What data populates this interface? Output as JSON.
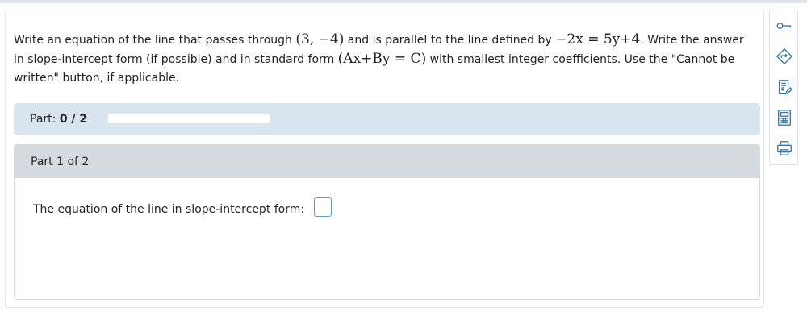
{
  "question": {
    "text_1": "Write an equation of the line that passes through ",
    "point": "(3, −4)",
    "text_2": " and is parallel to the line defined by ",
    "line_equation": "−2x = 5y+4",
    "text_3": ". Write the answer in slope-intercept form (if possible) and in standard form ",
    "standard_form": "(Ax+By = C)",
    "text_4": " with smallest integer coefficients. Use the \"Cannot be written\" button, if applicable."
  },
  "progress": {
    "label": "Part:",
    "value_text": "0 / 2",
    "completed_fraction": 0
  },
  "part": {
    "title": "Part 1 of 2",
    "answer_label": "The equation of the line in slope-intercept form:",
    "answer_value": ""
  },
  "tools": [
    {
      "icon": "key-icon"
    },
    {
      "icon": "hint-icon"
    },
    {
      "icon": "notes-icon"
    },
    {
      "icon": "calculator-icon"
    },
    {
      "icon": "print-icon"
    }
  ],
  "colors": {
    "progress_bg": "#d9e5ee",
    "part_header_bg": "#d4dadd",
    "input_border": "#5b9bc8",
    "icon_color": "#3c7aa4"
  }
}
